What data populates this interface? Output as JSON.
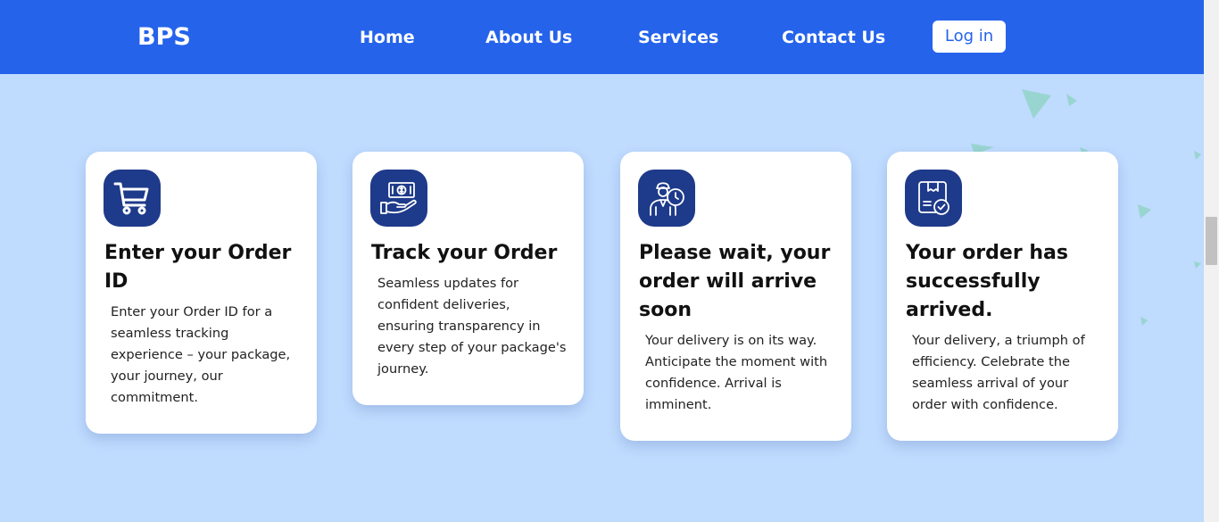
{
  "navbar": {
    "brand": "BPS",
    "links": {
      "home": "Home",
      "about": "About Us",
      "services": "Services",
      "contact": "Contact Us"
    },
    "login_label": "Log in"
  },
  "cards": [
    {
      "icon": "shopping-cart-icon",
      "title": "Enter your Order ID",
      "text": "Enter your Order ID for a seamless tracking experience – your package, your journey, our commitment."
    },
    {
      "icon": "money-hand-icon",
      "title": "Track your Order",
      "text": "Seamless updates for confident deliveries, ensuring transparency in every step of your package's journey."
    },
    {
      "icon": "delivery-person-clock-icon",
      "title": "Please wait, your order will arrive soon",
      "text": "Your delivery is on its way. Anticipate the moment with confidence. Arrival is imminent."
    },
    {
      "icon": "package-checkmark-icon",
      "title": "Your order has successfully arrived.",
      "text": "Your delivery, a triumph of efficiency. Celebrate the seamless arrival of your order with confidence."
    }
  ],
  "colors": {
    "navbar": "#2563eb",
    "background": "#bfdbfe",
    "icon_box": "#1e3a8a",
    "accent_triangles": "#99d5d0"
  }
}
